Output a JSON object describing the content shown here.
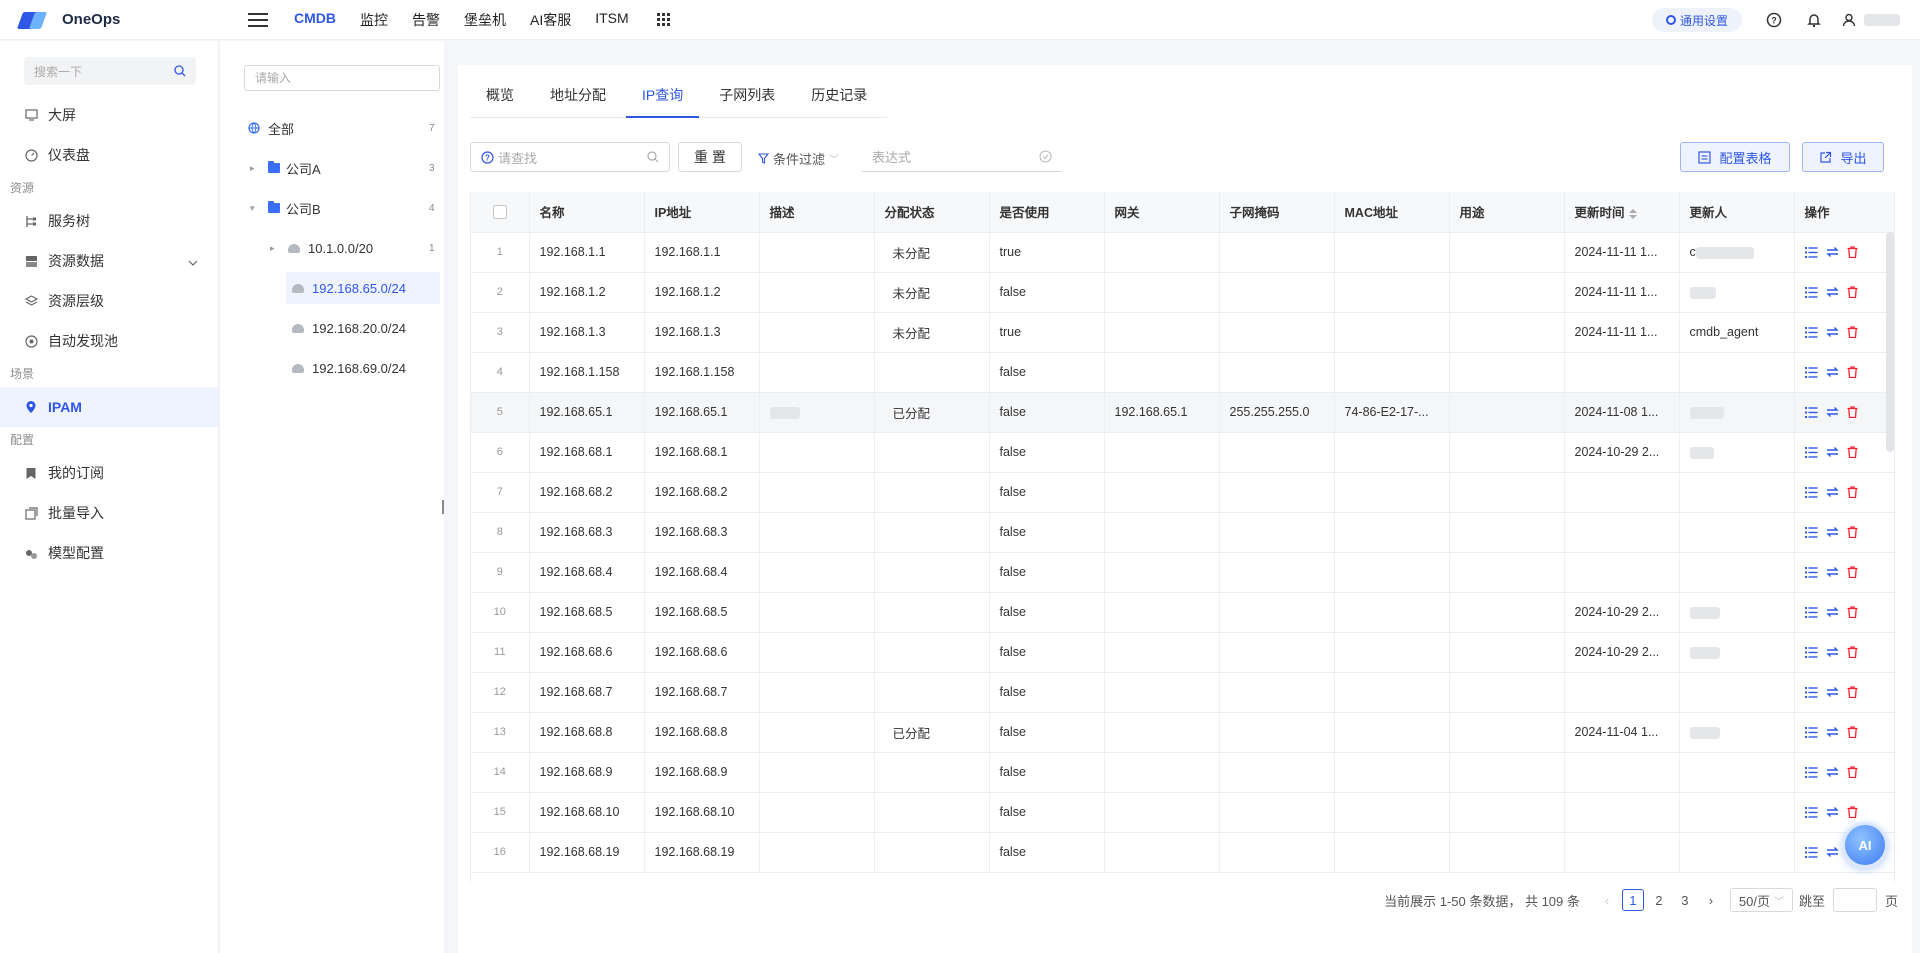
{
  "brand": {
    "name": "OneOps",
    "color": "#2f57e6"
  },
  "topnav": [
    "CMDB",
    "监控",
    "告警",
    "堡垒机",
    "AI客服",
    "ITSM"
  ],
  "top_right": {
    "settings": "通用设置"
  },
  "sidebar": {
    "search_placeholder": "搜索一下",
    "items1": [
      {
        "label": "大屏",
        "icon": "monitor-icon"
      },
      {
        "label": "仪表盘",
        "icon": "dashboard-icon"
      }
    ],
    "group_resources": "资源",
    "items2": [
      {
        "label": "服务树",
        "icon": "tree-icon"
      },
      {
        "label": "资源数据",
        "icon": "database-icon"
      },
      {
        "label": "资源层级",
        "icon": "layers-icon"
      },
      {
        "label": "自动发现池",
        "icon": "discover-icon"
      }
    ],
    "group_scenes": "场景",
    "ipam": "IPAM",
    "group_config": "配置",
    "items3": [
      {
        "label": "我的订阅",
        "icon": "bookmark-icon"
      },
      {
        "label": "批量导入",
        "icon": "import-icon"
      },
      {
        "label": "模型配置",
        "icon": "model-icon"
      }
    ]
  },
  "tree": {
    "search_placeholder": "请输入",
    "all": {
      "label": "全部",
      "count": "7"
    },
    "companyA": {
      "label": "公司A",
      "count": "3"
    },
    "companyB": {
      "label": "公司B",
      "count": "4"
    },
    "subnets": [
      {
        "label": "10.1.0.0/20",
        "count": "1"
      },
      {
        "label": "192.168.65.0/24",
        "count": ""
      },
      {
        "label": "192.168.20.0/24",
        "count": ""
      },
      {
        "label": "192.168.69.0/24",
        "count": ""
      }
    ]
  },
  "tabs": [
    "概览",
    "地址分配",
    "IP查询",
    "子网列表",
    "历史记录"
  ],
  "active_tab": "IP查询",
  "toolbar": {
    "search_placeholder": "请查找",
    "reset": "重 置",
    "filter": "条件过滤",
    "expr_placeholder": "表达式",
    "config_table": "配置表格",
    "export": "导出"
  },
  "columns": [
    "名称",
    "IP地址",
    "描述",
    "分配状态",
    "是否使用",
    "网关",
    "子网掩码",
    "MAC地址",
    "用途",
    "更新时间",
    "更新人",
    "操作"
  ],
  "rows": [
    {
      "idx": "1",
      "name": "192.168.1.1",
      "ip": "192.168.1.1",
      "desc": "",
      "status": "未分配",
      "used": "true",
      "gw": "",
      "mask": "",
      "mac": "",
      "purpose": "",
      "time": "2024-11-11 1...",
      "user": "c"
    },
    {
      "idx": "2",
      "name": "192.168.1.2",
      "ip": "192.168.1.2",
      "desc": "",
      "status": "未分配",
      "used": "false",
      "gw": "",
      "mask": "",
      "mac": "",
      "purpose": "",
      "time": "2024-11-11 1...",
      "user": ""
    },
    {
      "idx": "3",
      "name": "192.168.1.3",
      "ip": "192.168.1.3",
      "desc": "",
      "status": "未分配",
      "used": "true",
      "gw": "",
      "mask": "",
      "mac": "",
      "purpose": "",
      "time": "2024-11-11 1...",
      "user": "cmdb_agent"
    },
    {
      "idx": "4",
      "name": "192.168.1.158",
      "ip": "192.168.1.158",
      "desc": "",
      "status": "",
      "used": "false",
      "gw": "",
      "mask": "",
      "mac": "",
      "purpose": "",
      "time": "",
      "user": ""
    },
    {
      "idx": "5",
      "name": "192.168.65.1",
      "ip": "192.168.65.1",
      "desc": "",
      "status": "已分配",
      "used": "false",
      "gw": "192.168.65.1",
      "mask": "255.255.255.0",
      "mac": "74-86-E2-17-...",
      "purpose": "",
      "time": "2024-11-08 1...",
      "user": ""
    },
    {
      "idx": "6",
      "name": "192.168.68.1",
      "ip": "192.168.68.1",
      "desc": "",
      "status": "",
      "used": "false",
      "gw": "",
      "mask": "",
      "mac": "",
      "purpose": "",
      "time": "2024-10-29 2...",
      "user": ""
    },
    {
      "idx": "7",
      "name": "192.168.68.2",
      "ip": "192.168.68.2",
      "desc": "",
      "status": "",
      "used": "false",
      "gw": "",
      "mask": "",
      "mac": "",
      "purpose": "",
      "time": "",
      "user": ""
    },
    {
      "idx": "8",
      "name": "192.168.68.3",
      "ip": "192.168.68.3",
      "desc": "",
      "status": "",
      "used": "false",
      "gw": "",
      "mask": "",
      "mac": "",
      "purpose": "",
      "time": "",
      "user": ""
    },
    {
      "idx": "9",
      "name": "192.168.68.4",
      "ip": "192.168.68.4",
      "desc": "",
      "status": "",
      "used": "false",
      "gw": "",
      "mask": "",
      "mac": "",
      "purpose": "",
      "time": "",
      "user": ""
    },
    {
      "idx": "10",
      "name": "192.168.68.5",
      "ip": "192.168.68.5",
      "desc": "",
      "status": "",
      "used": "false",
      "gw": "",
      "mask": "",
      "mac": "",
      "purpose": "",
      "time": "2024-10-29 2...",
      "user": ""
    },
    {
      "idx": "11",
      "name": "192.168.68.6",
      "ip": "192.168.68.6",
      "desc": "",
      "status": "",
      "used": "false",
      "gw": "",
      "mask": "",
      "mac": "",
      "purpose": "",
      "time": "2024-10-29 2...",
      "user": ""
    },
    {
      "idx": "12",
      "name": "192.168.68.7",
      "ip": "192.168.68.7",
      "desc": "",
      "status": "",
      "used": "false",
      "gw": "",
      "mask": "",
      "mac": "",
      "purpose": "",
      "time": "",
      "user": ""
    },
    {
      "idx": "13",
      "name": "192.168.68.8",
      "ip": "192.168.68.8",
      "desc": "",
      "status": "已分配",
      "used": "false",
      "gw": "",
      "mask": "",
      "mac": "",
      "purpose": "",
      "time": "2024-11-04 1...",
      "user": ""
    },
    {
      "idx": "14",
      "name": "192.168.68.9",
      "ip": "192.168.68.9",
      "desc": "",
      "status": "",
      "used": "false",
      "gw": "",
      "mask": "",
      "mac": "",
      "purpose": "",
      "time": "",
      "user": ""
    },
    {
      "idx": "15",
      "name": "192.168.68.10",
      "ip": "192.168.68.10",
      "desc": "",
      "status": "",
      "used": "false",
      "gw": "",
      "mask": "",
      "mac": "",
      "purpose": "",
      "time": "",
      "user": ""
    },
    {
      "idx": "16",
      "name": "192.168.68.19",
      "ip": "192.168.68.19",
      "desc": "",
      "status": "",
      "used": "false",
      "gw": "",
      "mask": "",
      "mac": "",
      "purpose": "",
      "time": "",
      "user": ""
    }
  ],
  "pagination": {
    "summary": "当前展示 1-50 条数据， 共 109 条",
    "pages": [
      "1",
      "2",
      "3"
    ],
    "current": "1",
    "page_size": "50/页",
    "jump_label": "跳至",
    "page_suffix": "页"
  },
  "ai_button": "AI"
}
